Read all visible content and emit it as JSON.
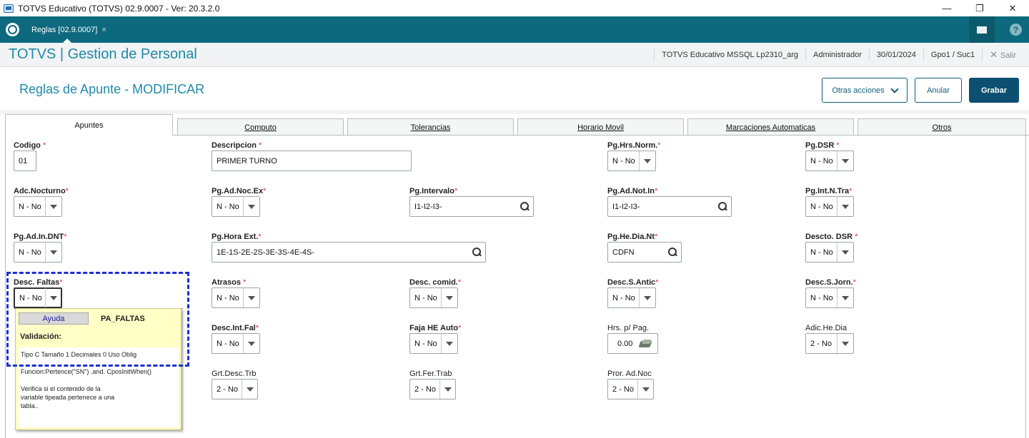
{
  "window": {
    "title": "TOTVS Educativo (TOTVS) 02.9.0007 - Ver: 20.3.2.0",
    "minimize": "—",
    "restore": "❐",
    "close": "✕"
  },
  "tabbar": {
    "doc_tab": "Reglas [02.9.0007]",
    "doc_close": "×",
    "help": "?"
  },
  "module": {
    "title": "TOTVS | Gestion de Personal",
    "environment": "TOTVS Educativo MSSQL Lp2310_arg",
    "user": "Administrador",
    "date": "30/01/2024",
    "branch": "Gpo1 / Suc1",
    "exit_icon": "✕",
    "exit": "Salir"
  },
  "page": {
    "title": "Reglas de Apunte - MODIFICAR"
  },
  "actions": {
    "more": "Otras acciones",
    "cancel": "Anular",
    "save": "Grabar"
  },
  "tabs": [
    "Apuntes",
    "Computo",
    "Tolerancias",
    "Horario Movil",
    "Marcaciones Automaticas",
    "Otros"
  ],
  "required_mark": "*",
  "fields": {
    "codigo": {
      "label": "Codigo",
      "value": "01"
    },
    "descripcion": {
      "label": "Descripcion",
      "value": "PRIMER TURNO"
    },
    "pg_hrs_norm": {
      "label": "Pg.Hrs.Norm.",
      "value": "N - No"
    },
    "pg_dsr": {
      "label": "Pg.DSR",
      "value": "N - No"
    },
    "adc_nocturno": {
      "label": "Adc.Nocturno",
      "value": "N - No"
    },
    "pg_ad_noc_ex": {
      "label": "Pg.Ad.Noc.Ex",
      "value": "N - No"
    },
    "pg_intervalo": {
      "label": "Pg.Intervalo",
      "value": "I1-I2-I3-"
    },
    "pg_ad_not_in": {
      "label": "Pg.Ad.Not.In",
      "value": "I1-I2-I3-"
    },
    "pg_int_n_tra": {
      "label": "Pg.Int.N.Tra",
      "value": "N - No"
    },
    "pg_ad_in_dnt": {
      "label": "Pg.Ad.In.DNT",
      "value": "N - No"
    },
    "pg_hora_ext": {
      "label": "Pg.Hora Ext.",
      "value": "1E-1S-2E-2S-3E-3S-4E-4S-"
    },
    "pg_he_dia_nt": {
      "label": "Pg.He.Dia.Nt",
      "value": "CDFN"
    },
    "descto_dsr": {
      "label": "Descto. DSR",
      "value": "N - No"
    },
    "desc_faltas": {
      "label": "Desc. Faltas",
      "value": "N - No"
    },
    "atrasos": {
      "label": "Atrasos",
      "value": "N - No"
    },
    "desc_comid": {
      "label": "Desc. comid.",
      "value": "N - No"
    },
    "desc_s_antic": {
      "label": "Desc.S.Antic",
      "value": "N - No"
    },
    "desc_s_jorn": {
      "label": "Desc.S.Jorn.",
      "value": "N - No"
    },
    "desc_int_fal": {
      "label": "Desc.Int.Fal",
      "value": "N - No"
    },
    "faja_he_auto": {
      "label": "Faja HE Auto",
      "value": "N - No"
    },
    "hrs_p_pag": {
      "label": "Hrs. p/ Pag.",
      "value": "0.00"
    },
    "adic_he_dia": {
      "label": "Adic.He.Dia",
      "value": "2 - No"
    },
    "grt_desc_trb": {
      "label": "Grt.Desc.Trb",
      "value": "2 - No"
    },
    "grt_fer_trab": {
      "label": "Grt.Fer.Trab",
      "value": "2 - No"
    },
    "pror_ad_noc": {
      "label": "Pror. Ad.Noc",
      "value": "2 - No"
    }
  },
  "tooltip": {
    "help_button": "Ayuda",
    "key": "PA_FALTAS",
    "validation_title": "Validación:",
    "line1": "Tipo C Tamaño    1 Decimales 0   Uso Oblig",
    "line2": "Funcion:Pertence(\"SN\") .and. CposInitWhen()",
    "line3": "Verifica si el contenido de la",
    "line4": "variable tipeada pertenece a una",
    "line5": "tabla.."
  },
  "colors": {
    "brand": "#0d6a7e",
    "accent": "#1f8aa8",
    "primary_button": "#0d4f70",
    "focus_outline": "#1d2fd6",
    "tooltip_bg": "#ffffc6"
  }
}
